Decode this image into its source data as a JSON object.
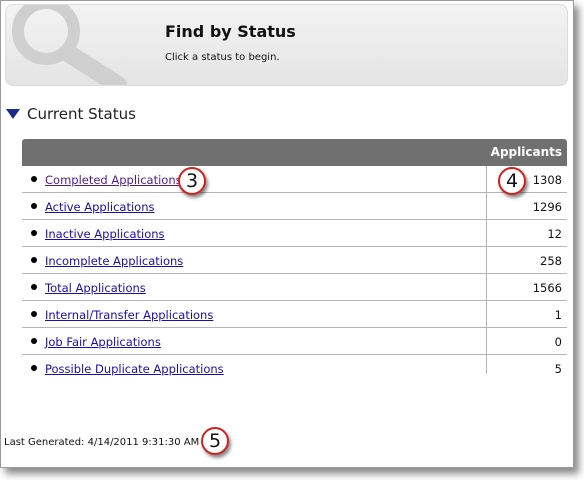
{
  "header": {
    "title": "Find by Status",
    "subtitle": "Click a status to begin."
  },
  "section": {
    "title": "Current Status"
  },
  "table": {
    "column_header": "Applicants",
    "rows": [
      {
        "label": "Completed Applications",
        "count": "1308"
      },
      {
        "label": "Active Applications",
        "count": "1296"
      },
      {
        "label": "Inactive Applications",
        "count": "12"
      },
      {
        "label": "Incomplete Applications",
        "count": "258"
      },
      {
        "label": "Total Applications",
        "count": "1566"
      },
      {
        "label": "Internal/Transfer Applications",
        "count": "1"
      },
      {
        "label": "Job Fair Applications",
        "count": "0"
      },
      {
        "label": "Possible Duplicate Applications",
        "count": "5"
      }
    ]
  },
  "footer": {
    "last_generated": "Last Generated: 4/14/2011 9:31:30 AM"
  },
  "callouts": {
    "c3": "3",
    "c4": "4",
    "c5": "5"
  },
  "icons": {
    "header": "magnifier-icon",
    "section_toggle": "triangle-down-icon",
    "row_marker": "bullet-icon"
  },
  "colors": {
    "link": "#1a0dab",
    "visited_link": "#551a8b",
    "table_header_bg": "#707070",
    "callout_border": "#d42020"
  }
}
